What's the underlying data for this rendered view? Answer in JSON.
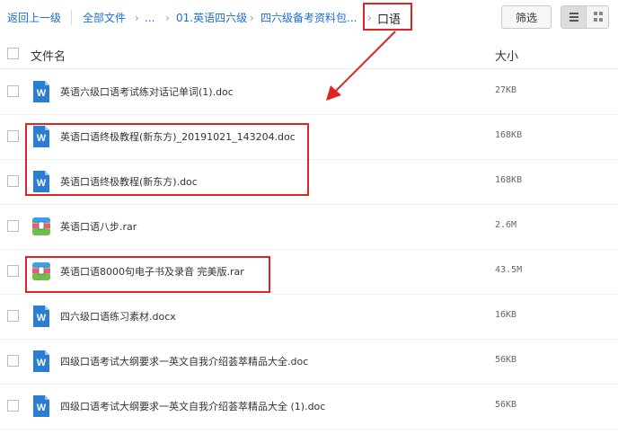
{
  "breadcrumb": {
    "back": "返回上一级",
    "all_files": "全部文件",
    "ellipsis": "...",
    "level1": "01.英语四六级",
    "level2": "四六级备考资料包...",
    "current": "口语"
  },
  "toolbar": {
    "filter_label": "筛选",
    "list_view_icon": "list-icon",
    "grid_view_icon": "grid-icon"
  },
  "table": {
    "col_name": "文件名",
    "col_size": "大小",
    "rows": [
      {
        "name": "英语六级口语考试练对话记单词(1).doc",
        "size": "27KB",
        "type": "doc"
      },
      {
        "name": "英语口语终极教程(新东方)_20191021_143204.doc",
        "size": "168KB",
        "type": "doc"
      },
      {
        "name": "英语口语终极教程(新东方).doc",
        "size": "168KB",
        "type": "doc"
      },
      {
        "name": "英语口语八步.rar",
        "size": "2.6M",
        "type": "rar"
      },
      {
        "name": "英语口语8000句电子书及录音 完美版.rar",
        "size": "43.5M",
        "type": "rar"
      },
      {
        "name": "四六级口语练习素材.docx",
        "size": "16KB",
        "type": "doc"
      },
      {
        "name": "四级口语考试大纲要求一英文自我介绍荟萃精品大全.doc",
        "size": "56KB",
        "type": "doc"
      },
      {
        "name": "四级口语考试大纲要求一英文自我介绍荟萃精品大全 (1).doc",
        "size": "56KB",
        "type": "doc"
      }
    ]
  },
  "colors": {
    "link": "#1c6fdb",
    "highlight": "#e02323",
    "doc_icon": "#2b7cd3"
  }
}
